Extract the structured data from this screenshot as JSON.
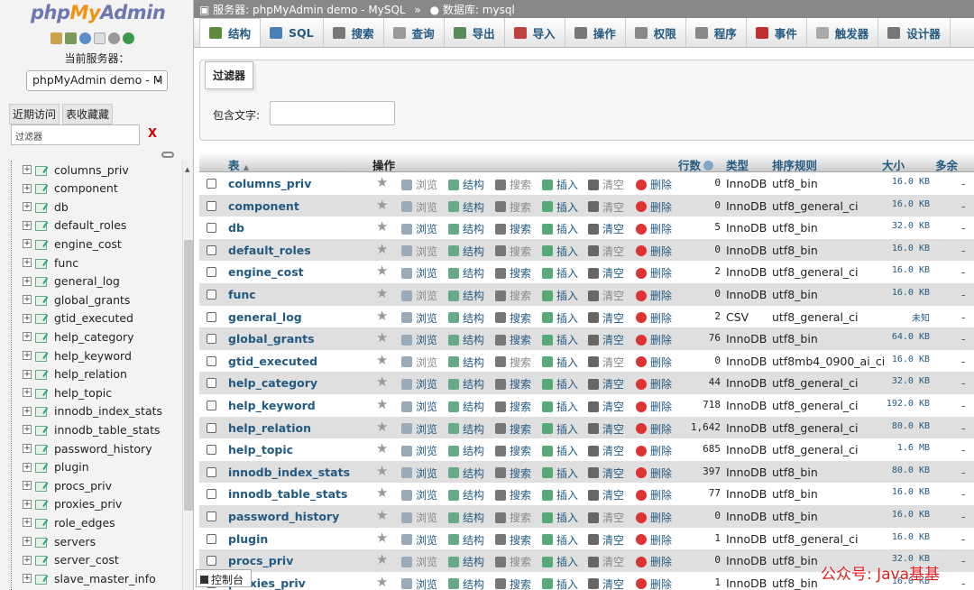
{
  "logo": {
    "part1": "php",
    "part2": "My",
    "part3": "Admin"
  },
  "sidebar": {
    "server_label": "当前服务器：",
    "server_select": "phpMyAdmin demo - M",
    "tab_recent": "近期访问",
    "tab_favorites": "表收藏藏",
    "filter_placeholder": "过滤器",
    "filter_clear": "X",
    "tree": [
      "columns_priv",
      "component",
      "db",
      "default_roles",
      "engine_cost",
      "func",
      "general_log",
      "global_grants",
      "gtid_executed",
      "help_category",
      "help_keyword",
      "help_relation",
      "help_topic",
      "innodb_index_stats",
      "innodb_table_stats",
      "password_history",
      "plugin",
      "procs_priv",
      "proxies_priv",
      "role_edges",
      "servers",
      "server_cost",
      "slave_master_info"
    ]
  },
  "breadcrumb": {
    "server_prefix": "服务器:",
    "server": "phpMyAdmin demo - MySQL",
    "arrow": "»",
    "db_prefix": "数据库:",
    "db": "mysql"
  },
  "tabs": [
    {
      "label": "结构",
      "icon": "structure-icon",
      "color": "#5b8c3a"
    },
    {
      "label": "SQL",
      "icon": "sql-icon",
      "color": "#4a7fb5"
    },
    {
      "label": "搜索",
      "icon": "search-icon",
      "color": "#777"
    },
    {
      "label": "查询",
      "icon": "query-icon",
      "color": "#999"
    },
    {
      "label": "导出",
      "icon": "export-icon",
      "color": "#5a8a5a"
    },
    {
      "label": "导入",
      "icon": "import-icon",
      "color": "#c04040"
    },
    {
      "label": "操作",
      "icon": "wrench-icon",
      "color": "#777"
    },
    {
      "label": "权限",
      "icon": "privileges-icon",
      "color": "#888"
    },
    {
      "label": "程序",
      "icon": "routines-icon",
      "color": "#888"
    },
    {
      "label": "事件",
      "icon": "events-icon",
      "color": "#c03030"
    },
    {
      "label": "触发器",
      "icon": "triggers-icon",
      "color": "#aaa"
    },
    {
      "label": "设计器",
      "icon": "designer-icon",
      "color": "#777"
    }
  ],
  "filter": {
    "legend": "过滤器",
    "label": "包含文字:",
    "value": ""
  },
  "table": {
    "headers": {
      "table": "表",
      "actions": "操作",
      "rows": "行数",
      "type": "类型",
      "collation": "排序规则",
      "size": "大小",
      "overhead": "多余"
    },
    "action_labels": {
      "browse": "浏览",
      "structure": "结构",
      "search": "搜索",
      "insert": "插入",
      "empty": "清空",
      "drop": "删除"
    },
    "rows": [
      {
        "name": "columns_priv",
        "rows": "0",
        "type": "InnoDB",
        "collation": "utf8_bin",
        "size": "16.0 KB",
        "overhead": "-"
      },
      {
        "name": "component",
        "rows": "0",
        "type": "InnoDB",
        "collation": "utf8_general_ci",
        "size": "16.0 KB",
        "overhead": "-"
      },
      {
        "name": "db",
        "rows": "5",
        "type": "InnoDB",
        "collation": "utf8_bin",
        "size": "32.0 KB",
        "overhead": "-"
      },
      {
        "name": "default_roles",
        "rows": "0",
        "type": "InnoDB",
        "collation": "utf8_bin",
        "size": "16.0 KB",
        "overhead": "-"
      },
      {
        "name": "engine_cost",
        "rows": "2",
        "type": "InnoDB",
        "collation": "utf8_general_ci",
        "size": "16.0 KB",
        "overhead": "-"
      },
      {
        "name": "func",
        "rows": "0",
        "type": "InnoDB",
        "collation": "utf8_bin",
        "size": "16.0 KB",
        "overhead": "-"
      },
      {
        "name": "general_log",
        "rows": "2",
        "type": "CSV",
        "collation": "utf8_general_ci",
        "size": "未知",
        "overhead": "-"
      },
      {
        "name": "global_grants",
        "rows": "76",
        "type": "InnoDB",
        "collation": "utf8_bin",
        "size": "64.0 KB",
        "overhead": "-"
      },
      {
        "name": "gtid_executed",
        "rows": "0",
        "type": "InnoDB",
        "collation": "utf8mb4_0900_ai_ci",
        "size": "16.0 KB",
        "overhead": "-"
      },
      {
        "name": "help_category",
        "rows": "44",
        "type": "InnoDB",
        "collation": "utf8_general_ci",
        "size": "32.0 KB",
        "overhead": "-"
      },
      {
        "name": "help_keyword",
        "rows": "718",
        "type": "InnoDB",
        "collation": "utf8_general_ci",
        "size": "192.0 KB",
        "overhead": "-"
      },
      {
        "name": "help_relation",
        "rows": "1,642",
        "type": "InnoDB",
        "collation": "utf8_general_ci",
        "size": "80.0 KB",
        "overhead": "-"
      },
      {
        "name": "help_topic",
        "rows": "685",
        "type": "InnoDB",
        "collation": "utf8_general_ci",
        "size": "1.6 MB",
        "overhead": "-"
      },
      {
        "name": "innodb_index_stats",
        "rows": "397",
        "type": "InnoDB",
        "collation": "utf8_bin",
        "size": "80.0 KB",
        "overhead": "-"
      },
      {
        "name": "innodb_table_stats",
        "rows": "77",
        "type": "InnoDB",
        "collation": "utf8_bin",
        "size": "16.0 KB",
        "overhead": "-"
      },
      {
        "name": "password_history",
        "rows": "0",
        "type": "InnoDB",
        "collation": "utf8_bin",
        "size": "16.0 KB",
        "overhead": "-"
      },
      {
        "name": "plugin",
        "rows": "1",
        "type": "InnoDB",
        "collation": "utf8_general_ci",
        "size": "16.0 KB",
        "overhead": "-"
      },
      {
        "name": "procs_priv",
        "rows": "0",
        "type": "InnoDB",
        "collation": "utf8_bin",
        "size": "32.0 KB",
        "overhead": "-"
      },
      {
        "name": "proxies_priv",
        "rows": "1",
        "type": "InnoDB",
        "collation": "utf8_bin",
        "size": "16.0 KB",
        "overhead": "-"
      }
    ]
  },
  "console": {
    "label": "控制台"
  },
  "watermark": "公众号: Java基基"
}
